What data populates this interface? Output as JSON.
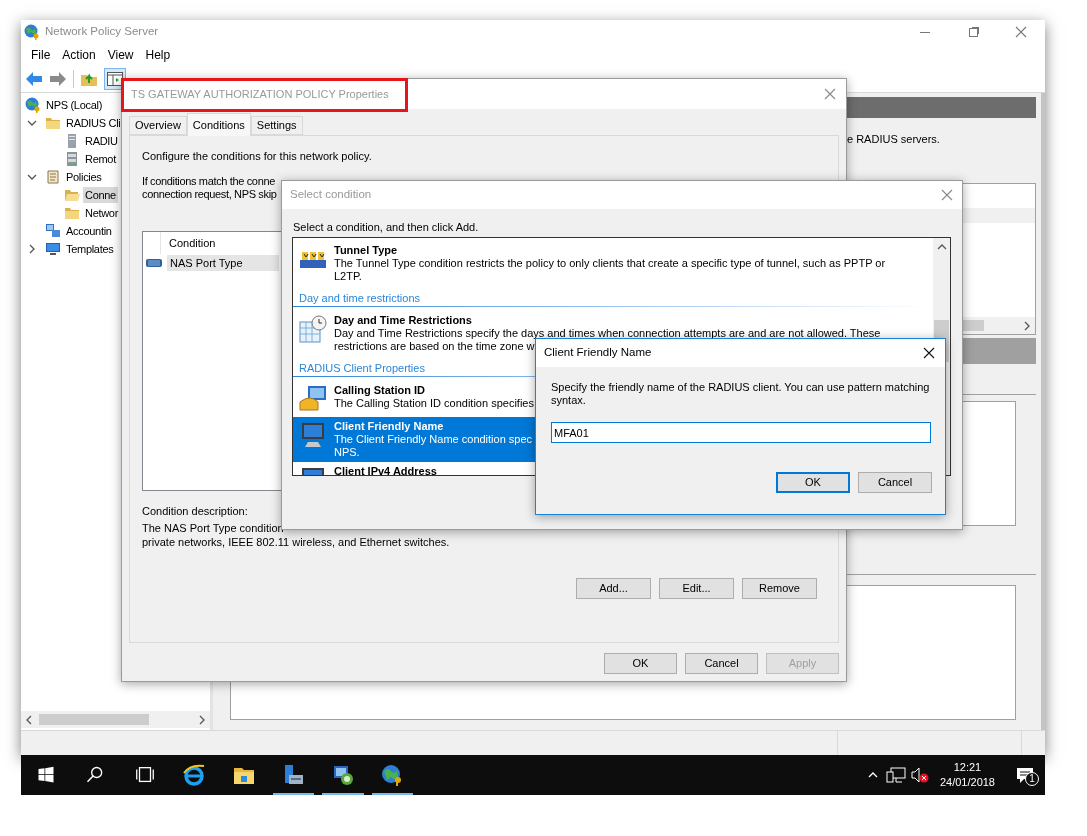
{
  "main_window": {
    "title": "Network Policy Server",
    "menu": [
      "File",
      "Action",
      "View",
      "Help"
    ],
    "tree": [
      {
        "label": "NPS (Local)",
        "selected": false,
        "children": [
          {
            "label": "RADIUS Cli",
            "expanded": true,
            "selected": false,
            "children": [
              {
                "label": "RADIU",
                "selected": false
              },
              {
                "label": "Remot",
                "selected": false
              }
            ]
          },
          {
            "label": "Policies",
            "expanded": true,
            "selected": false,
            "children": [
              {
                "label": "Conne",
                "selected": true
              },
              {
                "label": "Networ",
                "selected": false
              }
            ]
          },
          {
            "label": "Accountin",
            "selected": false
          },
          {
            "label": "Templates",
            "expanded": false,
            "selected": false
          }
        ]
      }
    ],
    "right_panel_text": "e RADIUS servers."
  },
  "properties_dialog": {
    "title": "TS GATEWAY AUTHORIZATION POLICY Properties",
    "title_highlighted": true,
    "tabs": [
      {
        "label": "Overview",
        "selected": false
      },
      {
        "label": "Conditions",
        "selected": true
      },
      {
        "label": "Settings",
        "selected": false
      }
    ],
    "intro": "Configure the conditions for this network policy.",
    "note_lines": [
      "If conditions match the conne",
      "connection request, NPS skip"
    ],
    "conditions": {
      "column": "Condition",
      "rows": [
        {
          "label": "NAS Port Type",
          "selected": true
        }
      ]
    },
    "description_label": "Condition description:",
    "description_lines": [
      "The NAS Port Type condition",
      "private networks, IEEE 802.11 wireless, and Ethernet switches."
    ],
    "list_buttons": [
      "Add...",
      "Edit...",
      "Remove"
    ],
    "buttons": [
      {
        "label": "OK",
        "disabled": false
      },
      {
        "label": "Cancel",
        "disabled": false
      },
      {
        "label": "Apply",
        "disabled": true
      }
    ]
  },
  "select_condition_dialog": {
    "title": "Select condition",
    "prompt": "Select a condition, and then click Add.",
    "items": [
      {
        "kind": "condition",
        "title": "Tunnel Type",
        "lines": [
          "The Tunnel Type condition restricts the policy to only clients that create a specific type of tunnel, such as PPTP or",
          "L2TP."
        ],
        "selected": false
      },
      {
        "kind": "group",
        "title": "Day and time restrictions"
      },
      {
        "kind": "condition",
        "title": "Day and Time Restrictions",
        "lines": [
          "Day and Time Restrictions specify the days and times when connection attempts are and are not allowed. These",
          "restrictions are based on the time zone w"
        ],
        "selected": false
      },
      {
        "kind": "group",
        "title": "RADIUS Client Properties"
      },
      {
        "kind": "condition",
        "title": "Calling Station ID",
        "lines": [
          "The Calling Station ID condition specifies"
        ],
        "selected": false
      },
      {
        "kind": "condition",
        "title": "Client Friendly Name",
        "lines": [
          "The Client Friendly Name condition spec",
          "NPS."
        ],
        "selected": true
      },
      {
        "kind": "condition",
        "title": "Client IPv4 Address",
        "selected": false
      }
    ]
  },
  "client_friendly_name_dialog": {
    "title": "Client Friendly Name",
    "prompt": "Specify the friendly name of the RADIUS client. You can use pattern matching syntax.",
    "value": "MFA01",
    "buttons": [
      {
        "label": "OK",
        "default": true
      },
      {
        "label": "Cancel",
        "default": false
      }
    ]
  },
  "taskbar": {
    "apps": [
      {
        "kind": "start"
      },
      {
        "kind": "search"
      },
      {
        "kind": "task-view"
      },
      {
        "kind": "browser",
        "running": false
      },
      {
        "kind": "files",
        "running": false
      },
      {
        "kind": "server-manager",
        "running": true
      },
      {
        "kind": "nps",
        "running": true
      },
      {
        "kind": "globe",
        "running": true
      }
    ],
    "time": "12:21",
    "date": "24/01/2018",
    "notifications": "1"
  }
}
